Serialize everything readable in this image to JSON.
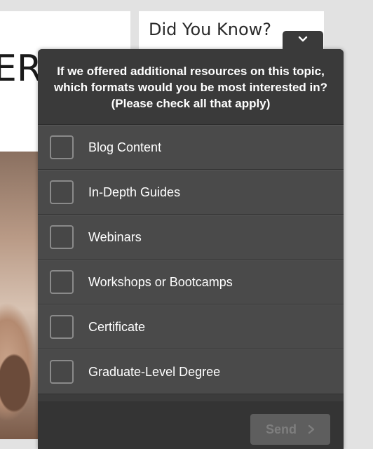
{
  "background": {
    "hero_text_fragment": "ER",
    "sidebar_title": "Did You Know?"
  },
  "survey": {
    "question": "If we offered additional resources on this topic, which formats would you be most interested in? (Please check all that apply)",
    "options": [
      {
        "label": "Blog Content",
        "checked": false
      },
      {
        "label": "In-Depth Guides",
        "checked": false
      },
      {
        "label": "Webinars",
        "checked": false
      },
      {
        "label": "Workshops or Bootcamps",
        "checked": false
      },
      {
        "label": "Certificate",
        "checked": false
      },
      {
        "label": "Graduate-Level Degree",
        "checked": false
      }
    ],
    "send_label": "Send",
    "collapse_icon": "chevron-down-icon",
    "send_icon": "chevron-right-icon"
  },
  "colors": {
    "panel": "#3c3c3c",
    "option_row": "#4a4a4a",
    "send_button": "#5e5e5e",
    "send_text": "#7e7e7e"
  }
}
